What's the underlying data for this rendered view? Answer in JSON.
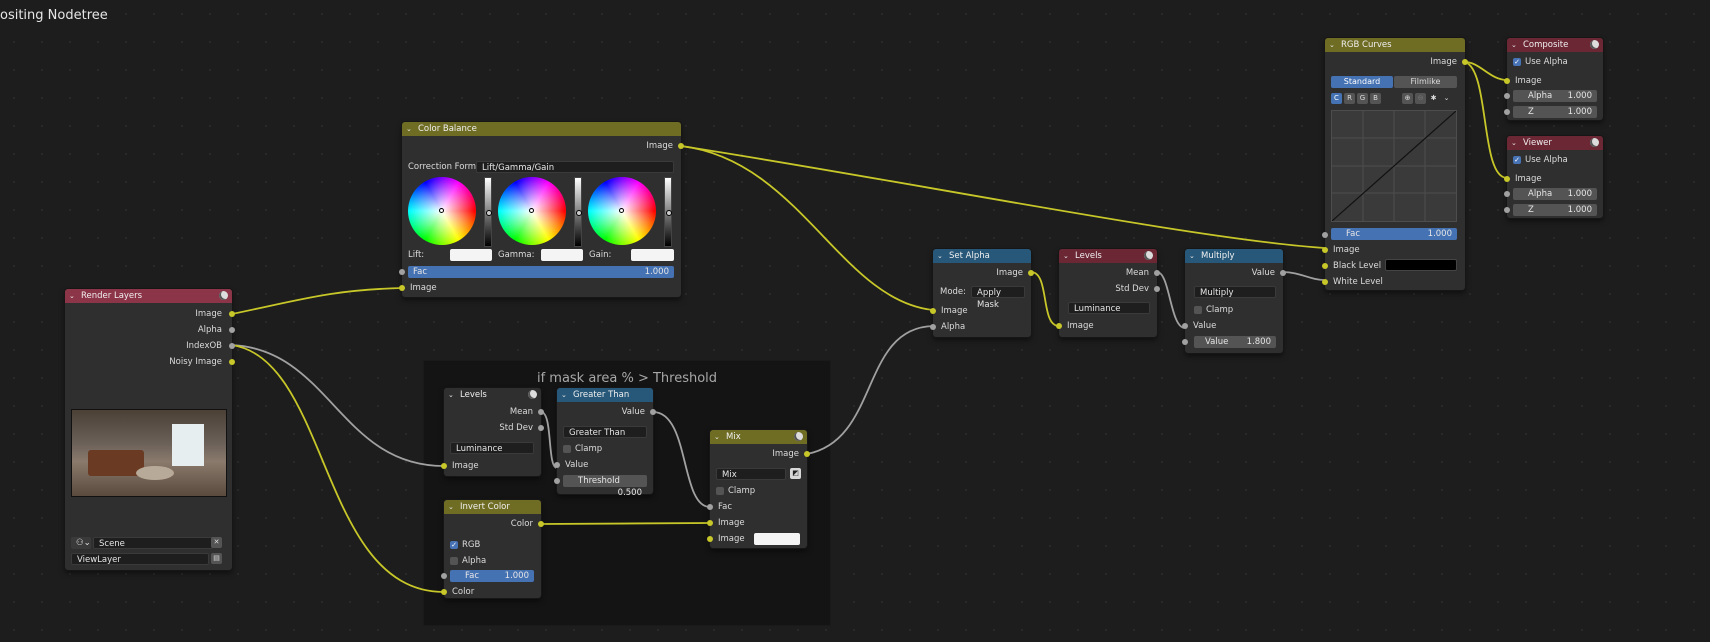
{
  "canvas": {
    "title": "ositing Nodetree",
    "frame_label": "if mask area % > Threshold"
  },
  "colors": {
    "link_yellow": "#c7c729",
    "link_gray": "#a1a1a1",
    "header_render": "#8d3548",
    "header_color": "#6f6d24",
    "header_converter": "#27587a",
    "header_output": "#6c2735",
    "accent_blue": "#4572b3"
  },
  "render_layers": {
    "title": "Render Layers",
    "outputs": [
      "Image",
      "Alpha",
      "IndexOB",
      "Noisy Image"
    ],
    "scene": "Scene",
    "view_layer": "ViewLayer"
  },
  "color_balance": {
    "title": "Color Balance",
    "output": "Image",
    "correction_label": "Correction Form...",
    "correction_value": "Lift/Gamma/Gain",
    "lift_label": "Lift:",
    "gamma_label": "Gamma:",
    "gain_label": "Gain:",
    "fac_label": "Fac",
    "fac_value": "1.000",
    "input": "Image"
  },
  "levels_frame": {
    "title": "Levels",
    "out_mean": "Mean",
    "out_std": "Std Dev",
    "mode": "Luminance",
    "input": "Image"
  },
  "greater_than": {
    "title": "Greater Than",
    "output": "Value",
    "op": "Greater Than",
    "clamp": "Clamp",
    "in_value": "Value",
    "threshold_label": "Threshold",
    "threshold_value": "0.500"
  },
  "invert_color": {
    "title": "Invert Color",
    "output": "Color",
    "rgb": "RGB",
    "alpha": "Alpha",
    "fac_label": "Fac",
    "fac_value": "1.000",
    "input": "Color"
  },
  "mix": {
    "title": "Mix",
    "output": "Image",
    "mode": "Mix",
    "clamp": "Clamp",
    "fac": "Fac",
    "image1": "Image",
    "image2": "Image"
  },
  "set_alpha": {
    "title": "Set Alpha",
    "output": "Image",
    "mode_label": "Mode:",
    "mode_value": "Apply Mask",
    "in_image": "Image",
    "in_alpha": "Alpha"
  },
  "levels_main": {
    "title": "Levels",
    "out_mean": "Mean",
    "out_std": "Std Dev",
    "mode": "Luminance",
    "input": "Image"
  },
  "multiply": {
    "title": "Multiply",
    "output": "Value",
    "op": "Multiply",
    "clamp": "Clamp",
    "in_value": "Value",
    "value_label": "Value",
    "value_value": "1.800"
  },
  "rgb_curves": {
    "title": "RGB Curves",
    "output": "Image",
    "tab_standard": "Standard",
    "tab_filmlike": "Filmlike",
    "channels": [
      "C",
      "R",
      "G",
      "B"
    ],
    "fac_label": "Fac",
    "fac_value": "1.000",
    "in_image": "Image",
    "in_black": "Black Level",
    "in_white": "White Level"
  },
  "composite": {
    "title": "Composite",
    "use_alpha": "Use Alpha",
    "image": "Image",
    "alpha_label": "Alpha",
    "alpha_value": "1.000",
    "z_label": "Z",
    "z_value": "1.000"
  },
  "viewer": {
    "title": "Viewer",
    "use_alpha": "Use Alpha",
    "image": "Image",
    "alpha_label": "Alpha",
    "alpha_value": "1.000",
    "z_label": "Z",
    "z_value": "1.000"
  }
}
